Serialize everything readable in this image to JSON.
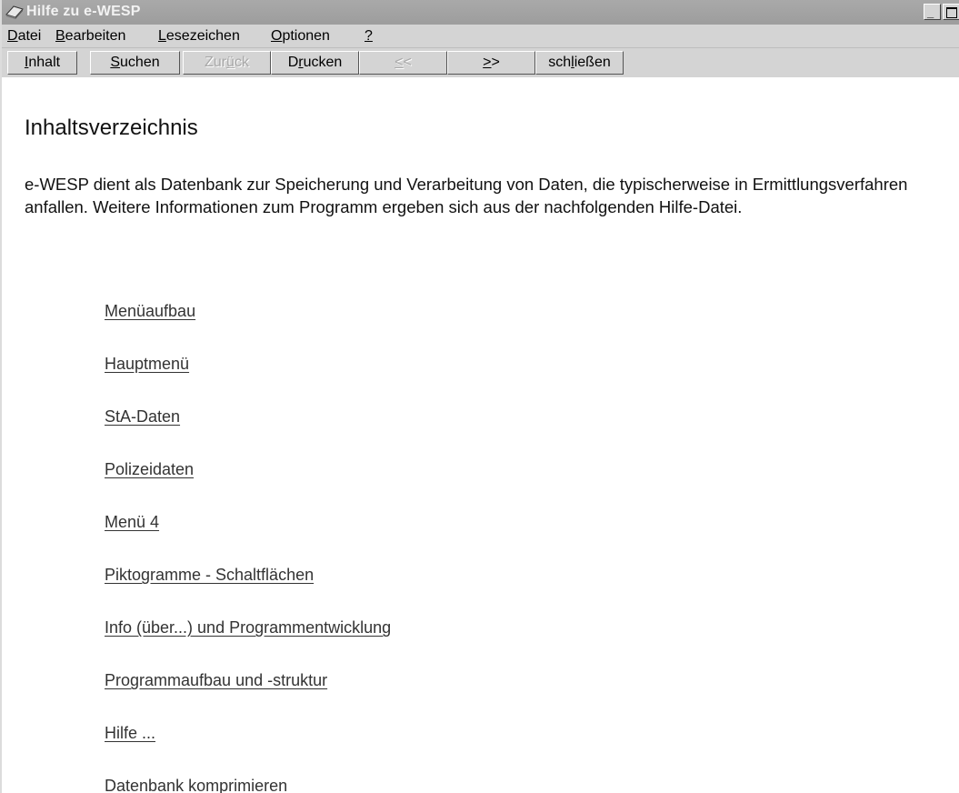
{
  "window": {
    "title": "Hilfe zu e-WESP"
  },
  "menubar": [
    {
      "accel": "D",
      "rest": "atei"
    },
    {
      "accel": "B",
      "rest": "earbeiten"
    },
    {
      "accel": "L",
      "rest": "esezeichen"
    },
    {
      "accel": "O",
      "rest": "ptionen"
    },
    {
      "accel": "?",
      "rest": ""
    }
  ],
  "toolbar": {
    "inhalt": {
      "accel": "I",
      "rest": "nhalt"
    },
    "suchen": {
      "accel": "S",
      "rest": "uchen"
    },
    "zurueck": {
      "pre": "Zur",
      "accel": "ü",
      "rest": "ck"
    },
    "drucken": {
      "pre": "D",
      "accel": "r",
      "rest": "ucken"
    },
    "back": {
      "accel": "<",
      "rest": "<"
    },
    "forward": {
      "accel": ">",
      "rest": ">"
    },
    "schliessen": {
      "pre": "sch",
      "accel": "l",
      "rest": "ießen"
    }
  },
  "content": {
    "title": "Inhaltsverzeichnis",
    "intro": "e-WESP dient als Datenbank zur Speicherung und Verarbeitung von Daten, die typischerweise in Ermittlungsverfahren anfallen. Weitere Informationen zum Programm ergeben sich aus der nachfolgenden Hilfe-Datei.",
    "links": [
      "Menüaufbau",
      "Hauptmenü",
      "StA-Daten",
      "Polizeidaten",
      "Menü 4",
      "Piktogramme - Schaltflächen",
      "Info (über...) und Programmentwicklung",
      "Programmaufbau und -struktur",
      "Hilfe ...",
      "Datenbank komprimieren"
    ]
  },
  "colors": {
    "titlebar": "#a3a3a3",
    "chrome": "#d4d4d4",
    "link": "#333333"
  }
}
